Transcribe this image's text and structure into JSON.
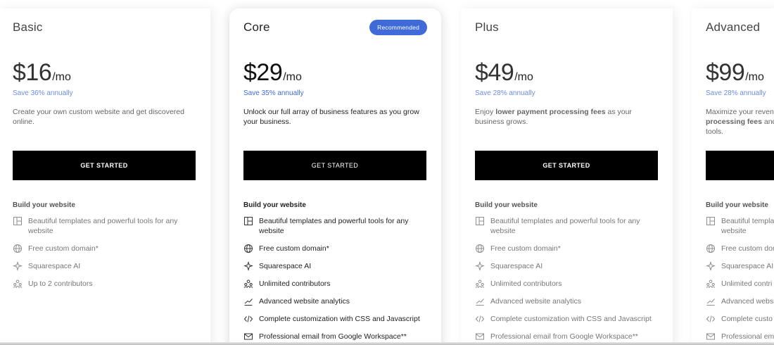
{
  "plans": [
    {
      "name": "Basic",
      "price": "$16",
      "unit": "/mo",
      "save": "Save 36% annually",
      "description": "Create your own custom website and get discovered online.",
      "cta": "GET STARTED",
      "section": "Build your website",
      "features": [
        {
          "icon": "template-icon",
          "text": "Beautiful templates and powerful tools for any website"
        },
        {
          "icon": "globe-icon",
          "text": "Free custom domain*"
        },
        {
          "icon": "sparkle-icon",
          "text": "Squarespace AI"
        },
        {
          "icon": "contributors-icon",
          "text": "Up to 2 contributors"
        }
      ]
    },
    {
      "name": "Core",
      "badge": "Recommended",
      "price": "$29",
      "unit": "/mo",
      "save": "Save 35% annually",
      "description": "Unlock our full array of business features as you grow your business.",
      "cta": "GET STARTED",
      "section": "Build your website",
      "features": [
        {
          "icon": "template-icon",
          "text": "Beautiful templates and powerful tools for any website"
        },
        {
          "icon": "globe-icon",
          "text": "Free custom domain*"
        },
        {
          "icon": "sparkle-icon",
          "text": "Squarespace AI"
        },
        {
          "icon": "contributors-icon",
          "text": "Unlimited contributors"
        },
        {
          "icon": "analytics-icon",
          "text": "Advanced website analytics"
        },
        {
          "icon": "code-icon",
          "text": "Complete customization with CSS and Javascript"
        },
        {
          "icon": "mail-icon",
          "text": "Professional email from Google Workspace**"
        }
      ]
    },
    {
      "name": "Plus",
      "price": "$49",
      "unit": "/mo",
      "save": "Save 28% annually",
      "description_pre": "Enjoy ",
      "description_bold": "lower payment processing fees",
      "description_post": " as your business grows.",
      "cta": "GET STARTED",
      "section": "Build your website",
      "features": [
        {
          "icon": "template-icon",
          "text": "Beautiful templates and powerful tools for any website"
        },
        {
          "icon": "globe-icon",
          "text": "Free custom domain*"
        },
        {
          "icon": "sparkle-icon",
          "text": "Squarespace AI"
        },
        {
          "icon": "contributors-icon",
          "text": "Unlimited contributors"
        },
        {
          "icon": "analytics-icon",
          "text": "Advanced website analytics"
        },
        {
          "icon": "code-icon",
          "text": "Complete customization with CSS and Javascript"
        },
        {
          "icon": "mail-icon",
          "text": "Professional email from Google Workspace**"
        }
      ]
    },
    {
      "name": "Advanced",
      "price": "$99",
      "unit": "/mo",
      "save": "Save 28% annually",
      "description_pre": "Maximize your revenu",
      "description_line2_bold": "processing fees",
      "description_line2_rest": " and a",
      "description_line3": "tools.",
      "cta": "",
      "section": "Build your website",
      "features": [
        {
          "icon": "template-icon",
          "text": "Beautiful templa"
        },
        {
          "icon": "template-icon",
          "text": "website"
        },
        {
          "icon": "globe-icon",
          "text": "Free custom dom"
        },
        {
          "icon": "sparkle-icon",
          "text": "Squarespace AI"
        },
        {
          "icon": "contributors-icon",
          "text": "Unlimited contri"
        },
        {
          "icon": "analytics-icon",
          "text": "Advanced websi"
        },
        {
          "icon": "code-icon",
          "text": "Complete custo"
        },
        {
          "icon": "mail-icon",
          "text": "Professional em"
        }
      ]
    }
  ],
  "colors": {
    "accent": "#3f6bd9",
    "cta_bg": "#000000"
  }
}
